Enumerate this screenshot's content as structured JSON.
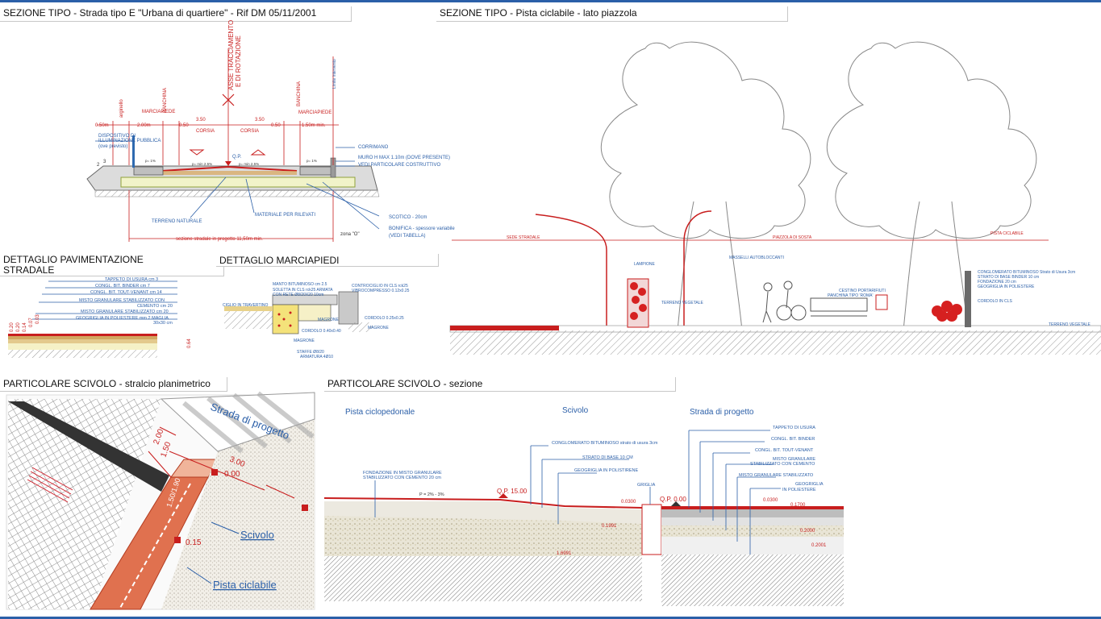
{
  "titles": {
    "sezione_strada": "SEZIONE TIPO - Strada tipo E \"Urbana di quartiere\" - Rif DM 05/11/2001",
    "sezione_pista": "SEZIONE TIPO - Pista ciclabile - lato piazzola",
    "pavimentazione": "DETTAGLIO PAVIMENTAZIONE STRADALE",
    "marciapiedi": "DETTAGLIO MARCIAPIEDI",
    "scivolo_plan": "PARTICOLARE SCIVOLO - stralcio planimetrico",
    "scivolo_sez": "PARTICOLARE SCIVOLO - sezione"
  },
  "road": {
    "asse": "ASSE TRACCIAMENTO",
    "rotazione": "E DI ROTAZIONE",
    "banchina_l": "BANCHINA",
    "banchina_r": "BANCHINA",
    "arginello": "arginello",
    "limite": "Limite intervento",
    "marciapiede_l": "MARCIAPIEDE",
    "marciapiede_r": "MARCIAPIEDE",
    "d050a": "0.50m",
    "d200": "2.00m",
    "d050b": "0.50",
    "d350a": "3.50",
    "d350b": "3.50",
    "d050c": "0.50",
    "d150": "1.50m min.",
    "corsia_l": "CORSIA",
    "corsia_r": "CORSIA",
    "qp": "Q.P.",
    "p1a": "p= 1%",
    "p25a": "p= min 2.5%",
    "p25b": "p= min 2.5%",
    "p1b": "p= 1%",
    "slope2": "2",
    "slope3": "3",
    "dispositivo1": "DISPOSITIVO DI",
    "dispositivo2": "ILLUMINAZIONE PUBBLICA",
    "dispositivo3": "(ove previsto)",
    "corrimano": "CORRIMANO",
    "muro": "MURO H MAX 1.10m (DOVE PRESENTE)",
    "vedi": "VEDI PARTICOLARE COSTRUTTIVO",
    "terreno": "TERRENO NATURALE",
    "materiale": "MATERIALE PER RILEVATI",
    "scotico": "SCOTICO - 20cm",
    "bonifica": "BONIFICA - spessore variabile",
    "vedi_tab": "(VEDI TABELLA)",
    "sezione_progetto": "sezione stradale in progetto 11,50m min.",
    "zona": "zona \"O\""
  },
  "pista": {
    "sede": "SEDE STRADALE",
    "piazzola": "PIAZZOLA DI SOSTA",
    "pista_label": "PISTA CICLABILE",
    "lampione": "LAMPIONE",
    "cestino": "CESTINO PORTARIFIUTI",
    "panchina": "PANCHINA TIPO 'ROMA'",
    "terreno_veg": "TERRENO VEGETALE",
    "terreno_vegr": "TERRENO VEGETALE",
    "masselli": "MASSELLI AUTOBLOCCANTI",
    "conglomerato": "CONGLOMERATO BITUMINOSO Strato di Usura 3cm",
    "strato_base": "STRATO DI BASE BINDER 10 cm",
    "fondazione": "FONDAZIONE 20 cm",
    "geogriglia": "GEOGRIGLIA IN POLIESTERE",
    "cordolo": "CORDOLO IN CLS"
  },
  "pav": {
    "l1": "TAPPETO DI USURA cm 3",
    "l2": "CONGL. BIT. BINDER cm 7",
    "l3": "CONGL. BIT. TOUT-VENANT cm 14",
    "l4": "MISTO GRANULARE STABILIZZATO CON",
    "l5": "CEMENTO cm 20",
    "l6": "MISTO GRANULARE STABILIZZATO cm 20",
    "l7": "GEOGRIGLIA IN POLIESTERE mm 2 MAGLIA",
    "l8": "30x30 cm",
    "d1": "0.20",
    "d2": "0.20",
    "d3": "0.14",
    "d4": "0.07",
    "d5": "0.03",
    "tot": "0.64"
  },
  "marc": {
    "manto": "MANTO BITUMINOSO cm 2.5",
    "soletta": "SOLETTA IN CLS rck25 ARMATA",
    "rete": "CON RETE Ø8/20X20 10cm",
    "cordolo": "CORDOLO 0.25x0.25",
    "cordolo2": "CORDOLO 0.40x0.40",
    "ciglio": "CIGLIO IN TRAVERTINO",
    "controcig": "CONTROCIGLIO IN CLS rck25",
    "vibro": "VIBROCOMPRESSO 0.12x0.25",
    "magrone1": "MAGRONE",
    "magrone2": "MAGRONE",
    "magrone3": "MAGRONE",
    "staffe": "STAFFE Ø8/20",
    "armatura": "ARMATURA 4Ø10"
  },
  "plan": {
    "strada": "Strada di progetto",
    "d200": "2.00",
    "d150": "1.50",
    "d300": "3.00",
    "q000": "0.00",
    "q015": "0.15",
    "d150190": "1.50/1.90",
    "scivolo": "Scivolo",
    "pista": "Pista ciclabile"
  },
  "sez": {
    "pista": "Pista ciclopedonale",
    "scivolo": "Scivolo",
    "strada": "Strada di progetto",
    "conglomerato": "CONGLOMERATO BITUMINOSO strato di usura 3cm",
    "strato": "STRATO DI BASE 10 CM",
    "geogriglia": "GEOGRIGLIA IN POLISTIRENE",
    "griglia": "GRIGLIA",
    "fondazione1": "FONDAZIONE IN MISTO GRANULARE",
    "fondazione2": "STABILIZZATO CON CEMENTO 20 cm",
    "qp15": "Q.P. 15.00",
    "qp0": "Q.P. 0.00",
    "tappeto": "TAPPETO DI USURA",
    "binder": "CONGL. BIT. BINDER",
    "tout": "CONGL. BIT. TOUT-VENANT",
    "misto1a": "MISTO GRANULARE",
    "misto1b": "STABILIZZATO CON CEMENTO",
    "misto2": "MISTO GRANULARE STABILIZZATO",
    "geo1": "GEOGRIGLIA",
    "geo2": "IN POLIESTERE",
    "dim_1": "0.0300",
    "dim_2": "0.1991",
    "dim_3": "0.0300",
    "dim_4": "0.1700",
    "dim_5": "0.2000",
    "dim_6": "0.2001",
    "dim_bot": "1.6991",
    "pct": "P = 2% - 3%"
  }
}
